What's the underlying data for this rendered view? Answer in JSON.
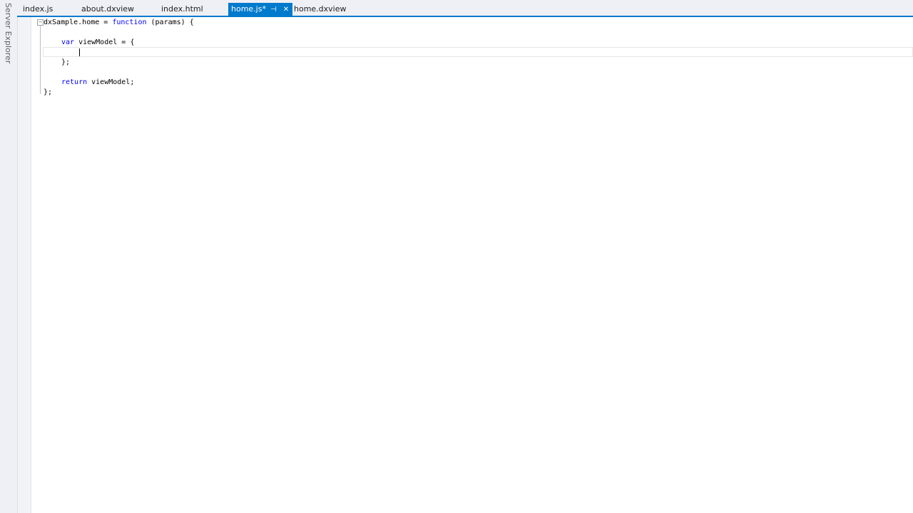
{
  "side_panel": {
    "label": "Server Explorer"
  },
  "tabs": [
    {
      "label": "index.js",
      "active": false
    },
    {
      "label": "about.dxview",
      "active": false
    },
    {
      "label": "index.html",
      "active": false
    },
    {
      "label": "home.js*",
      "active": true
    },
    {
      "label": "home.dxview",
      "active": false
    }
  ],
  "active_tab_icons": {
    "pin": "pin-icon",
    "close": "close-icon"
  },
  "code": {
    "line1_a": "dxSample.home = ",
    "line1_kw": "function",
    "line1_b": " (params) {",
    "line3_kw": "var",
    "line3_b": " viewModel = {",
    "line5": "};",
    "line7_kw": "return",
    "line7_b": " viewModel;",
    "line8": "};"
  },
  "colors": {
    "accent": "#007acc",
    "keyword": "#0000ff",
    "change_marker": "#f0d050"
  }
}
